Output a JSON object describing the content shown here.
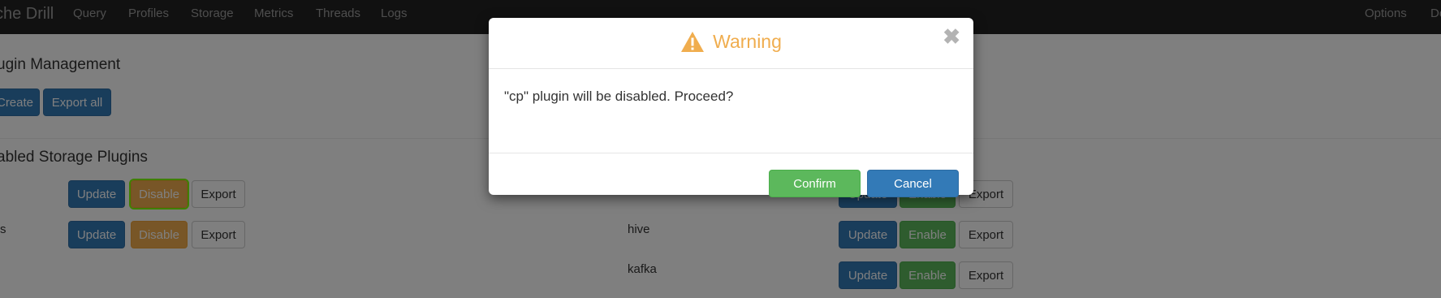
{
  "navbar": {
    "brand": "che Drill",
    "items": [
      "Query",
      "Profiles",
      "Storage",
      "Metrics",
      "Threads",
      "Logs"
    ],
    "right_items": [
      "Options",
      "Do"
    ]
  },
  "page": {
    "title": "ugin Management",
    "create_label": "Create",
    "export_all_label": "Export all",
    "enabled_title": "abled Storage Plugins",
    "enabled_rows": [
      {
        "name": "",
        "update": "Update",
        "disable": "Disable",
        "export": "Export"
      },
      {
        "name": "s",
        "update": "Update",
        "disable": "Disable",
        "export": "Export"
      }
    ],
    "disabled_rows": [
      {
        "name": "",
        "update": "Update",
        "enable": "Enable",
        "export": "Export"
      },
      {
        "name": "hive",
        "update": "Update",
        "enable": "Enable",
        "export": "Export"
      },
      {
        "name": "kafka",
        "update": "Update",
        "enable": "Enable",
        "export": "Export"
      }
    ]
  },
  "modal": {
    "title": "Warning",
    "close_glyph": "✖",
    "message": "\"cp\" plugin will be disabled. Proceed?",
    "confirm_label": "Confirm",
    "cancel_label": "Cancel",
    "title_color": "#f0ad4e"
  },
  "icons": {
    "warning": "warning-icon",
    "close": "close-icon"
  }
}
